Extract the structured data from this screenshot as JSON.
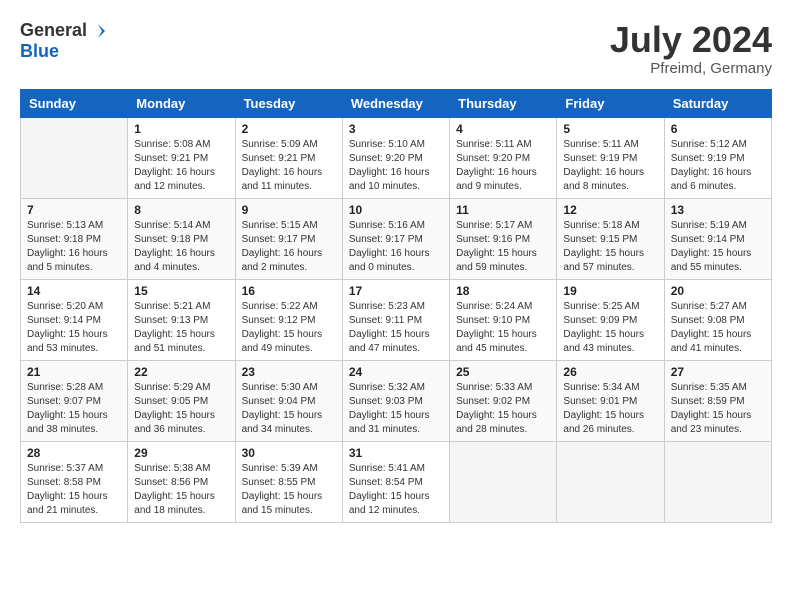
{
  "header": {
    "logo_general": "General",
    "logo_blue": "Blue",
    "month_year": "July 2024",
    "location": "Pfreimd, Germany"
  },
  "weekdays": [
    "Sunday",
    "Monday",
    "Tuesday",
    "Wednesday",
    "Thursday",
    "Friday",
    "Saturday"
  ],
  "weeks": [
    [
      {
        "day": "",
        "info": ""
      },
      {
        "day": "1",
        "info": "Sunrise: 5:08 AM\nSunset: 9:21 PM\nDaylight: 16 hours\nand 12 minutes."
      },
      {
        "day": "2",
        "info": "Sunrise: 5:09 AM\nSunset: 9:21 PM\nDaylight: 16 hours\nand 11 minutes."
      },
      {
        "day": "3",
        "info": "Sunrise: 5:10 AM\nSunset: 9:20 PM\nDaylight: 16 hours\nand 10 minutes."
      },
      {
        "day": "4",
        "info": "Sunrise: 5:11 AM\nSunset: 9:20 PM\nDaylight: 16 hours\nand 9 minutes."
      },
      {
        "day": "5",
        "info": "Sunrise: 5:11 AM\nSunset: 9:19 PM\nDaylight: 16 hours\nand 8 minutes."
      },
      {
        "day": "6",
        "info": "Sunrise: 5:12 AM\nSunset: 9:19 PM\nDaylight: 16 hours\nand 6 minutes."
      }
    ],
    [
      {
        "day": "7",
        "info": "Sunrise: 5:13 AM\nSunset: 9:18 PM\nDaylight: 16 hours\nand 5 minutes."
      },
      {
        "day": "8",
        "info": "Sunrise: 5:14 AM\nSunset: 9:18 PM\nDaylight: 16 hours\nand 4 minutes."
      },
      {
        "day": "9",
        "info": "Sunrise: 5:15 AM\nSunset: 9:17 PM\nDaylight: 16 hours\nand 2 minutes."
      },
      {
        "day": "10",
        "info": "Sunrise: 5:16 AM\nSunset: 9:17 PM\nDaylight: 16 hours\nand 0 minutes."
      },
      {
        "day": "11",
        "info": "Sunrise: 5:17 AM\nSunset: 9:16 PM\nDaylight: 15 hours\nand 59 minutes."
      },
      {
        "day": "12",
        "info": "Sunrise: 5:18 AM\nSunset: 9:15 PM\nDaylight: 15 hours\nand 57 minutes."
      },
      {
        "day": "13",
        "info": "Sunrise: 5:19 AM\nSunset: 9:14 PM\nDaylight: 15 hours\nand 55 minutes."
      }
    ],
    [
      {
        "day": "14",
        "info": "Sunrise: 5:20 AM\nSunset: 9:14 PM\nDaylight: 15 hours\nand 53 minutes."
      },
      {
        "day": "15",
        "info": "Sunrise: 5:21 AM\nSunset: 9:13 PM\nDaylight: 15 hours\nand 51 minutes."
      },
      {
        "day": "16",
        "info": "Sunrise: 5:22 AM\nSunset: 9:12 PM\nDaylight: 15 hours\nand 49 minutes."
      },
      {
        "day": "17",
        "info": "Sunrise: 5:23 AM\nSunset: 9:11 PM\nDaylight: 15 hours\nand 47 minutes."
      },
      {
        "day": "18",
        "info": "Sunrise: 5:24 AM\nSunset: 9:10 PM\nDaylight: 15 hours\nand 45 minutes."
      },
      {
        "day": "19",
        "info": "Sunrise: 5:25 AM\nSunset: 9:09 PM\nDaylight: 15 hours\nand 43 minutes."
      },
      {
        "day": "20",
        "info": "Sunrise: 5:27 AM\nSunset: 9:08 PM\nDaylight: 15 hours\nand 41 minutes."
      }
    ],
    [
      {
        "day": "21",
        "info": "Sunrise: 5:28 AM\nSunset: 9:07 PM\nDaylight: 15 hours\nand 38 minutes."
      },
      {
        "day": "22",
        "info": "Sunrise: 5:29 AM\nSunset: 9:05 PM\nDaylight: 15 hours\nand 36 minutes."
      },
      {
        "day": "23",
        "info": "Sunrise: 5:30 AM\nSunset: 9:04 PM\nDaylight: 15 hours\nand 34 minutes."
      },
      {
        "day": "24",
        "info": "Sunrise: 5:32 AM\nSunset: 9:03 PM\nDaylight: 15 hours\nand 31 minutes."
      },
      {
        "day": "25",
        "info": "Sunrise: 5:33 AM\nSunset: 9:02 PM\nDaylight: 15 hours\nand 28 minutes."
      },
      {
        "day": "26",
        "info": "Sunrise: 5:34 AM\nSunset: 9:01 PM\nDaylight: 15 hours\nand 26 minutes."
      },
      {
        "day": "27",
        "info": "Sunrise: 5:35 AM\nSunset: 8:59 PM\nDaylight: 15 hours\nand 23 minutes."
      }
    ],
    [
      {
        "day": "28",
        "info": "Sunrise: 5:37 AM\nSunset: 8:58 PM\nDaylight: 15 hours\nand 21 minutes."
      },
      {
        "day": "29",
        "info": "Sunrise: 5:38 AM\nSunset: 8:56 PM\nDaylight: 15 hours\nand 18 minutes."
      },
      {
        "day": "30",
        "info": "Sunrise: 5:39 AM\nSunset: 8:55 PM\nDaylight: 15 hours\nand 15 minutes."
      },
      {
        "day": "31",
        "info": "Sunrise: 5:41 AM\nSunset: 8:54 PM\nDaylight: 15 hours\nand 12 minutes."
      },
      {
        "day": "",
        "info": ""
      },
      {
        "day": "",
        "info": ""
      },
      {
        "day": "",
        "info": ""
      }
    ]
  ]
}
